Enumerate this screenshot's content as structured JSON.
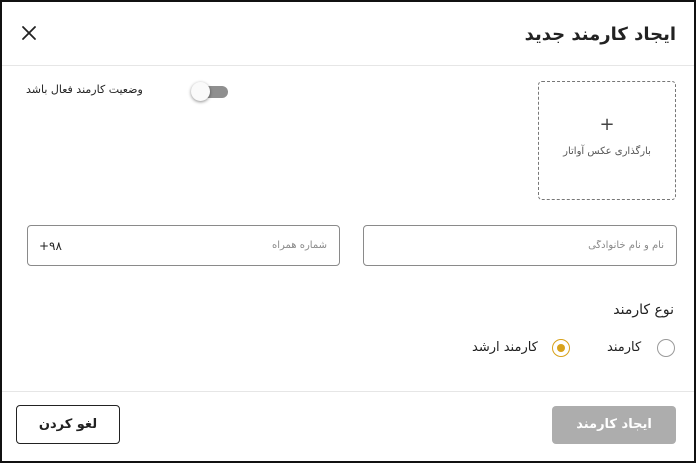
{
  "dialog": {
    "title": "ایجاد کارمند جدید"
  },
  "avatar_upload": {
    "plus": "+",
    "label": "بارگذاری عکس آواتار"
  },
  "status_toggle": {
    "label": "وضعیت کارمند فعال باشد",
    "checked": false
  },
  "fields": {
    "full_name": {
      "placeholder": "نام و نام خانوادگی",
      "value": ""
    },
    "phone": {
      "placeholder": "شماره همراه",
      "value": "",
      "prefix": "+۹۸"
    }
  },
  "employee_type": {
    "heading": "نوع کارمند",
    "options": [
      {
        "label": "کارمند",
        "selected": false
      },
      {
        "label": "کارمند ارشد",
        "selected": true
      }
    ]
  },
  "footer": {
    "create_label": "ایجاد کارمند",
    "cancel_label": "لغو کردن"
  },
  "colors": {
    "accent": "#d8a21b",
    "disabled_button": "#adadad",
    "toggle_off": "#8f8f8f"
  }
}
